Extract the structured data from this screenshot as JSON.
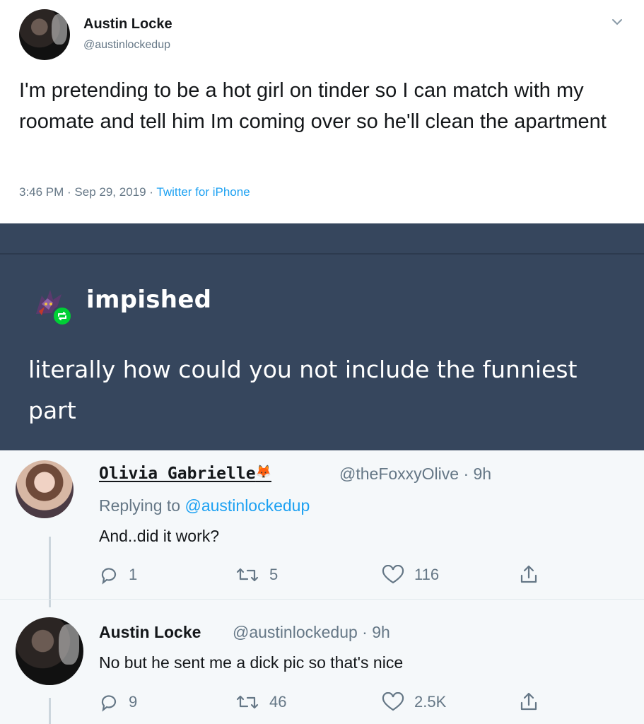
{
  "top_tweet": {
    "author_name": "Austin Locke",
    "author_handle": "@austinlockedup",
    "text": "I'm pretending to be a hot girl on tinder so I can match with my roomate and tell him Im coming over so he'll clean the apartment",
    "time": "3:46 PM",
    "date": "Sep 29, 2019",
    "separator": " · ",
    "source": "Twitter for iPhone"
  },
  "tumblr_post": {
    "username": "impished",
    "text": "literally how could you not include the funniest part"
  },
  "replies": [
    {
      "name": "Olivia Gabrielle",
      "handle_time": "@theFoxxyOlive · 9h",
      "replying_prefix": "Replying to ",
      "replying_to": "@austinlockedup",
      "text": "And..did it work?",
      "replies_count": "1",
      "retweets_count": "5",
      "likes_count": "116"
    },
    {
      "name": "Austin Locke",
      "handle_time": "@austinlockedup · 9h",
      "text": "No but he sent me a dick pic so that's nice",
      "replies_count": "9",
      "retweets_count": "46",
      "likes_count": "2.5K"
    }
  ],
  "icons": {
    "reply": "reply-icon",
    "retweet": "retweet-icon",
    "like": "heart-icon",
    "share": "share-icon",
    "chevron": "chevron-down-icon",
    "reblog": "reblog-icon"
  },
  "colors": {
    "tumblr_bg": "#36465d",
    "twitter_blue": "#1da1f2",
    "muted": "#657786",
    "reblog_green": "#00cf35"
  }
}
